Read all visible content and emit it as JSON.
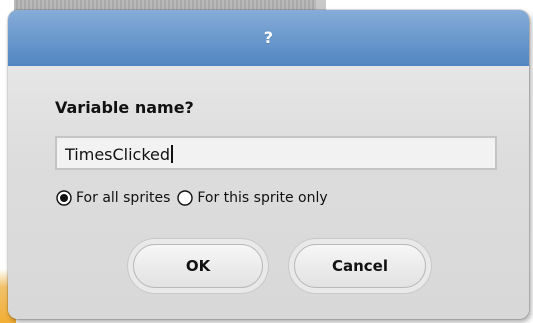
{
  "background": {
    "accent_color": "#f3ae33"
  },
  "dialog": {
    "title": "?",
    "prompt": "Variable name?",
    "input": {
      "value": "TimesClicked",
      "placeholder": ""
    },
    "scope_options": [
      {
        "label": "For all sprites",
        "selected": true
      },
      {
        "label": "For this sprite only",
        "selected": false
      }
    ],
    "buttons": {
      "ok": "OK",
      "cancel": "Cancel"
    },
    "colors": {
      "titlebar_top": "#87add8",
      "titlebar_bottom": "#5386c1",
      "body": "#dddddd"
    }
  }
}
